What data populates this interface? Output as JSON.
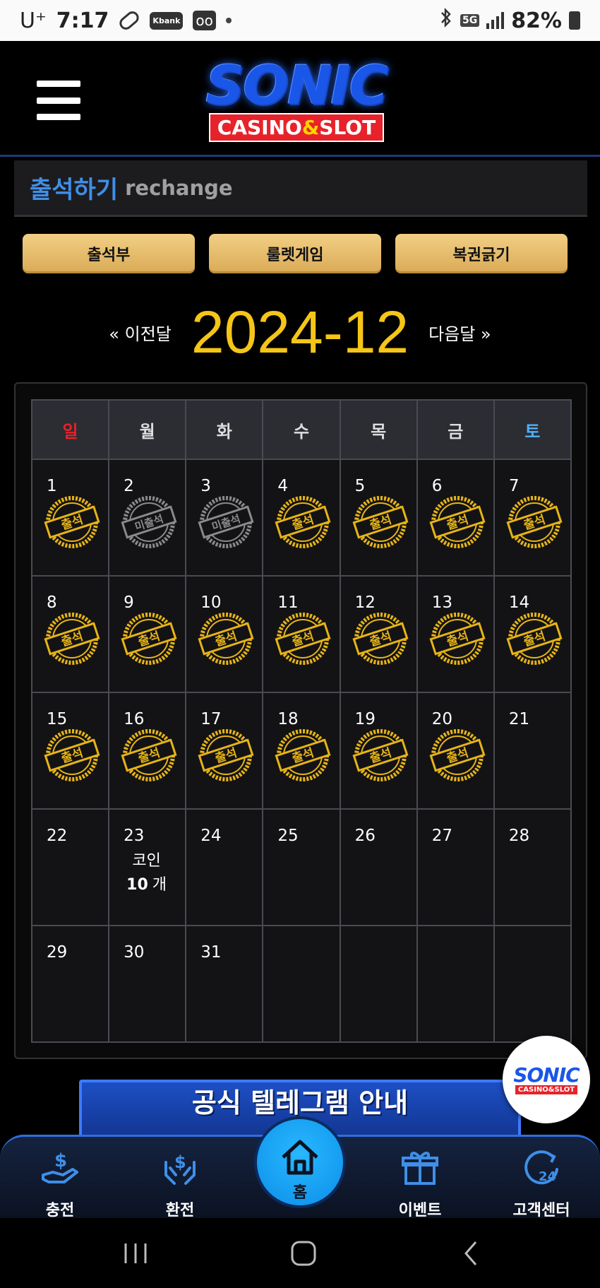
{
  "status_bar": {
    "carrier": "U⁺",
    "time": "7:17",
    "kbank": "Kbank",
    "network": "5G",
    "battery": "82%"
  },
  "header": {
    "logo_main": "SONIC",
    "logo_sub_left": "CASINO",
    "logo_sub_amp": "&",
    "logo_sub_right": "SLOT"
  },
  "section": {
    "title_ko": "출석하기",
    "title_en": "rechange"
  },
  "tabs": [
    "출석부",
    "룰렛게임",
    "복권긁기"
  ],
  "month_nav": {
    "prev": "« 이전달",
    "current": "2024-12",
    "next": "다음달 »"
  },
  "calendar": {
    "weekdays": [
      "일",
      "월",
      "화",
      "수",
      "목",
      "금",
      "토"
    ],
    "stamp_attended": "출석",
    "stamp_absent": "미출석",
    "coin_label": "코인",
    "coin_amount": "10",
    "coin_unit": "개",
    "weeks": [
      [
        {
          "day": "1",
          "status": "attended"
        },
        {
          "day": "2",
          "status": "absent"
        },
        {
          "day": "3",
          "status": "absent"
        },
        {
          "day": "4",
          "status": "attended"
        },
        {
          "day": "5",
          "status": "attended"
        },
        {
          "day": "6",
          "status": "attended"
        },
        {
          "day": "7",
          "status": "attended"
        }
      ],
      [
        {
          "day": "8",
          "status": "attended"
        },
        {
          "day": "9",
          "status": "attended"
        },
        {
          "day": "10",
          "status": "attended"
        },
        {
          "day": "11",
          "status": "attended"
        },
        {
          "day": "12",
          "status": "attended"
        },
        {
          "day": "13",
          "status": "attended"
        },
        {
          "day": "14",
          "status": "attended"
        }
      ],
      [
        {
          "day": "15",
          "status": "attended"
        },
        {
          "day": "16",
          "status": "attended"
        },
        {
          "day": "17",
          "status": "attended"
        },
        {
          "day": "18",
          "status": "attended"
        },
        {
          "day": "19",
          "status": "attended"
        },
        {
          "day": "20",
          "status": "attended"
        },
        {
          "day": "21",
          "status": "none"
        }
      ],
      [
        {
          "day": "22",
          "status": "none"
        },
        {
          "day": "23",
          "status": "coin"
        },
        {
          "day": "24",
          "status": "none"
        },
        {
          "day": "25",
          "status": "none"
        },
        {
          "day": "26",
          "status": "none"
        },
        {
          "day": "27",
          "status": "none"
        },
        {
          "day": "28",
          "status": "none"
        }
      ],
      [
        {
          "day": "29",
          "status": "none"
        },
        {
          "day": "30",
          "status": "none"
        },
        {
          "day": "31",
          "status": "none"
        },
        {
          "day": "",
          "status": "none"
        },
        {
          "day": "",
          "status": "none"
        },
        {
          "day": "",
          "status": "none"
        },
        {
          "day": "",
          "status": "none"
        }
      ]
    ]
  },
  "banner": {
    "text": "공식 텔레그램 안내"
  },
  "float_logo": {
    "main": "SONIC",
    "sub": "CASINO&SLOT"
  },
  "bottom_nav": {
    "charge": "충전",
    "exchange": "환전",
    "home": "홈",
    "event": "이벤트",
    "support": "고객센터"
  },
  "colors": {
    "accent_gold": "#f5c518",
    "title_blue": "#3f8fe8",
    "sunday_red": "#e8222a",
    "saturday_blue": "#4fb3ff",
    "home_blue": "#0c8ee8"
  }
}
